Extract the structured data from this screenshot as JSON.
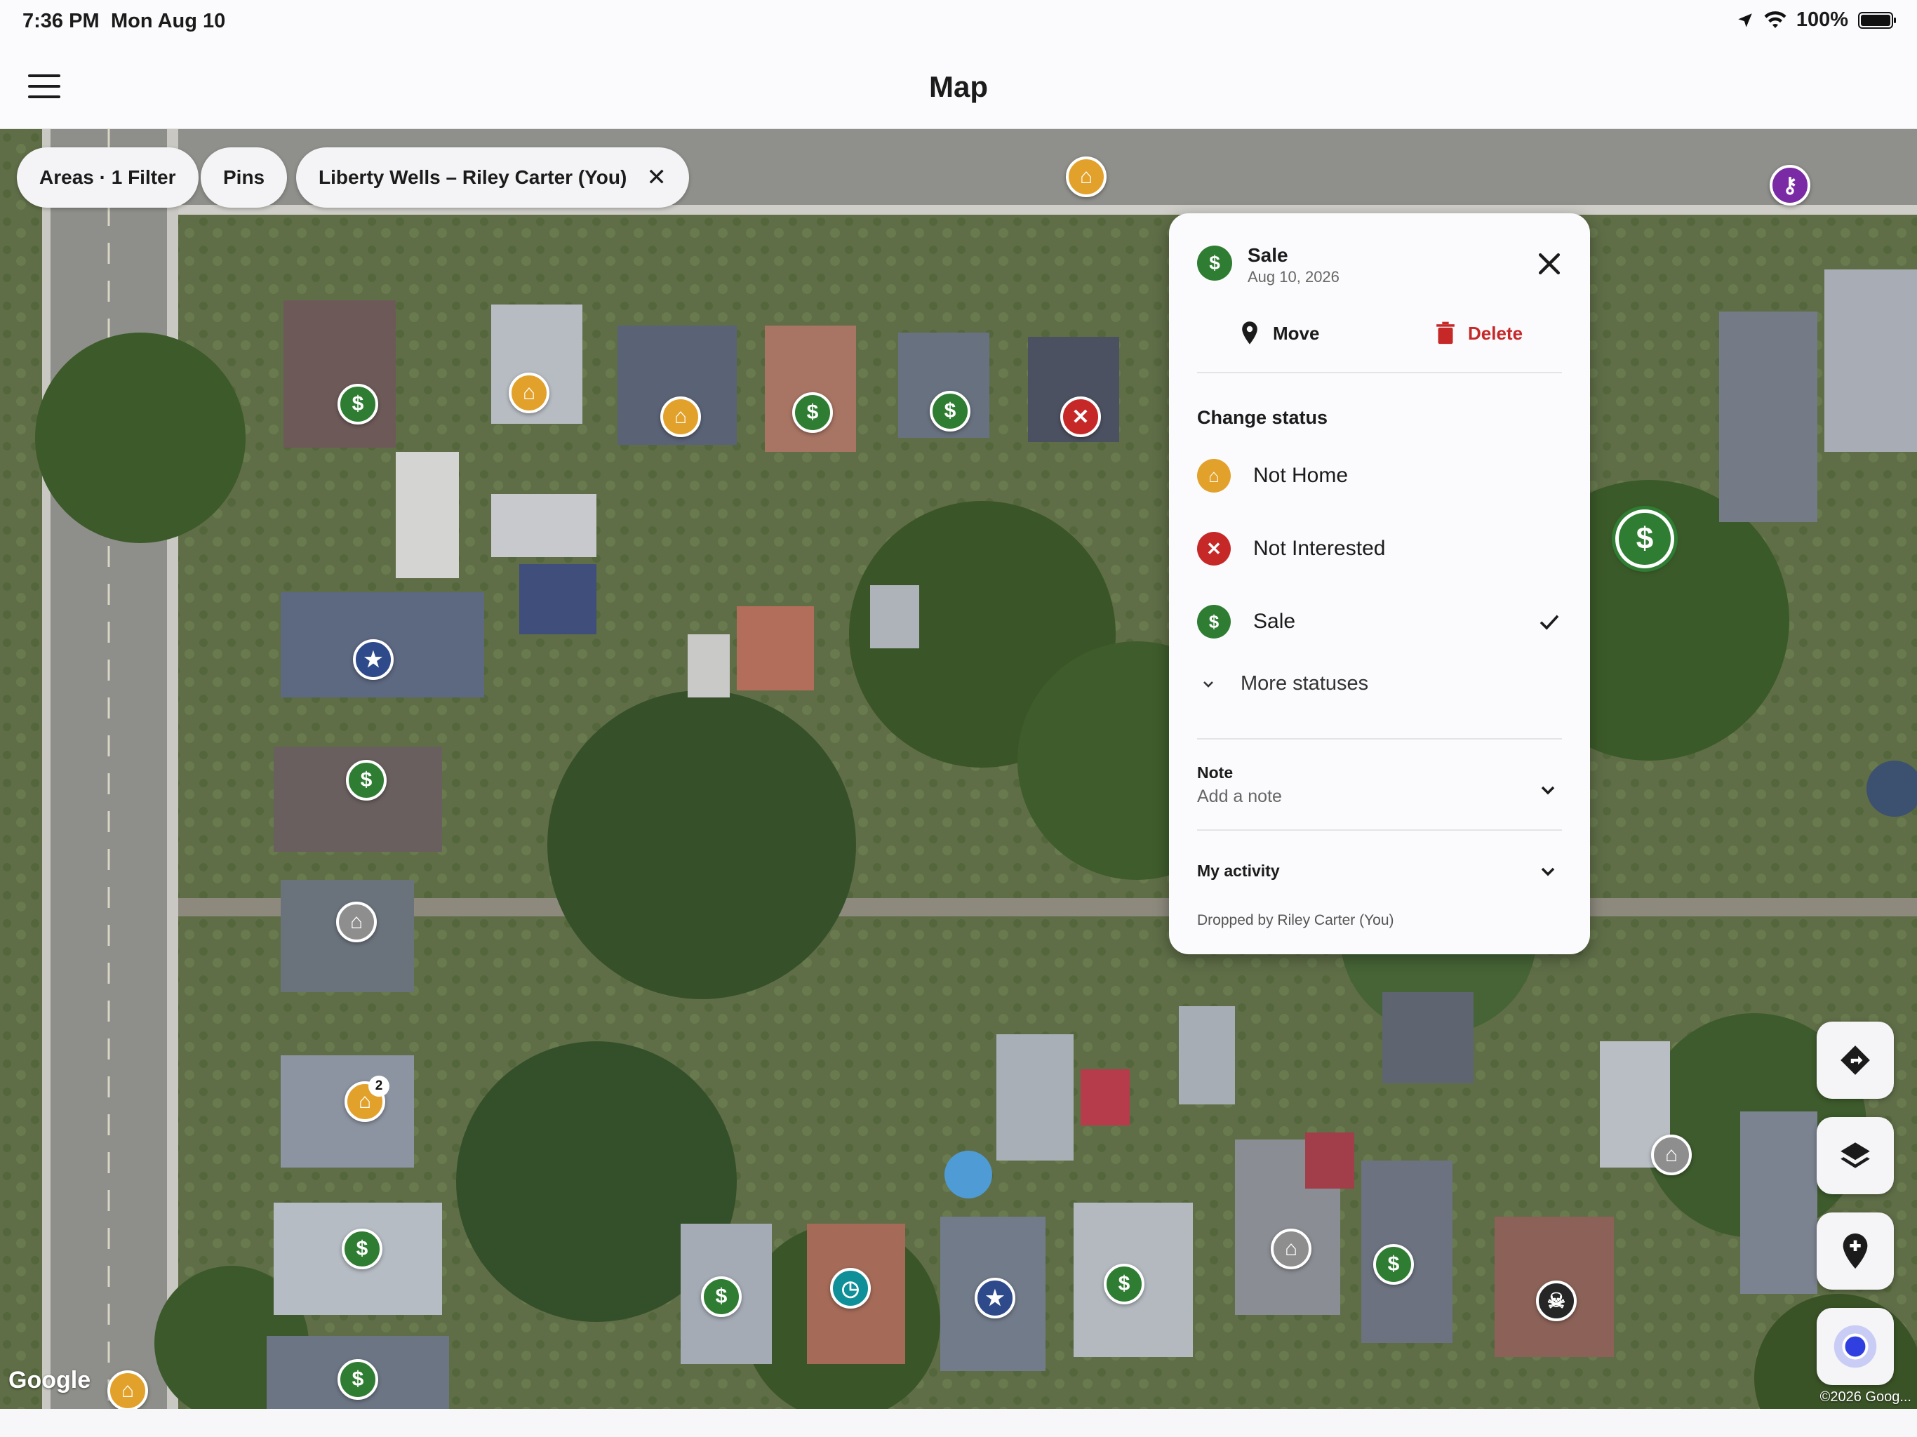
{
  "status_bar": {
    "time": "7:36 PM",
    "date": "Mon Aug 10",
    "battery": "100%"
  },
  "app_bar": {
    "title": "Map"
  },
  "chips": [
    {
      "label": "Areas · 1 Filter"
    },
    {
      "label": "Pins"
    },
    {
      "label": "Liberty Wells – Riley Carter (You)"
    }
  ],
  "map": {
    "attribution": "Google",
    "copyright": "©2026 Goog...",
    "pins": [
      {
        "type": "nothome",
        "badge": ""
      },
      {
        "type": "key",
        "badge": ""
      },
      {
        "type": "sale",
        "badge": ""
      },
      {
        "type": "nothome",
        "badge": ""
      },
      {
        "type": "nothome",
        "badge": ""
      },
      {
        "type": "sale",
        "badge": ""
      },
      {
        "type": "sale",
        "badge": ""
      },
      {
        "type": "notint",
        "badge": ""
      },
      {
        "type": "sale",
        "badge": "",
        "selected": true
      },
      {
        "type": "star",
        "badge": ""
      },
      {
        "type": "sale",
        "badge": ""
      },
      {
        "type": "house",
        "badge": ""
      },
      {
        "type": "nothome",
        "badge": "2"
      },
      {
        "type": "house",
        "badge": ""
      },
      {
        "type": "sale",
        "badge": ""
      },
      {
        "type": "house",
        "badge": ""
      },
      {
        "type": "sale",
        "badge": ""
      },
      {
        "type": "sale",
        "badge": ""
      },
      {
        "type": "clock",
        "badge": ""
      },
      {
        "type": "star",
        "badge": ""
      },
      {
        "type": "sale",
        "badge": ""
      },
      {
        "type": "skull",
        "badge": ""
      },
      {
        "type": "sale",
        "badge": ""
      },
      {
        "type": "nothome",
        "badge": ""
      }
    ]
  },
  "side_buttons": [
    {
      "icon": "directions-icon"
    },
    {
      "icon": "layers-icon"
    },
    {
      "icon": "add-pin-icon"
    },
    {
      "icon": "my-location-icon"
    }
  ],
  "panel": {
    "status": "Sale",
    "date": "Aug 10, 2026",
    "move_label": "Move",
    "delete_label": "Delete",
    "change_status_heading": "Change status",
    "statuses": [
      {
        "label": "Not Home",
        "color": "#e2a12a",
        "checked": false
      },
      {
        "label": "Not Interested",
        "color": "#c62828",
        "checked": false
      },
      {
        "label": "Sale",
        "color": "#2e7d32",
        "checked": true
      }
    ],
    "more_statuses": "More statuses",
    "note_title": "Note",
    "note_placeholder": "Add a note",
    "activity_title": "My activity",
    "dropped_by": "Dropped by Riley Carter (You)"
  },
  "colors": {
    "sale": "#2e7d32",
    "not_home": "#e2a12a",
    "not_interested": "#c62828",
    "delete": "#c62828"
  }
}
